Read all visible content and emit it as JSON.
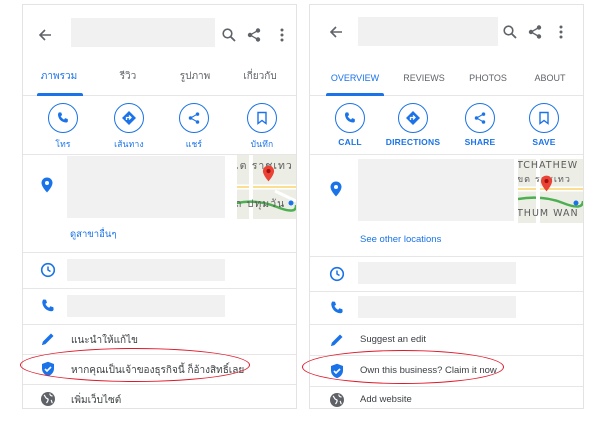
{
  "colors": {
    "accent": "#1a73e8",
    "placeholder_gray": "#f1f1f1",
    "highlight_oval": "#e0192a",
    "map_pin": "#ea4335"
  },
  "panels": [
    {
      "language": "th",
      "icons": {
        "back": "arrow-left-icon",
        "search": "search-icon",
        "share": "share-icon",
        "more": "more-vert-icon"
      },
      "tabs": [
        "ภาพรวม",
        "รีวิว",
        "รูปภาพ",
        "เกี่ยวกับ"
      ],
      "active_tab": 0,
      "actions": [
        {
          "label": "โทร",
          "icon": "phone-icon"
        },
        {
          "label": "เส้นทาง",
          "icon": "directions-icon"
        },
        {
          "label": "แชร์",
          "icon": "share-icon"
        },
        {
          "label": "บันทึก",
          "icon": "bookmark-icon"
        }
      ],
      "map_text": [
        "เต ราชเทว",
        "ถ ปทุมวัน"
      ],
      "other_locations": "ดูสาขาอื่นๆ",
      "suggest_edit": "แนะนำให้แก้ไข",
      "claim_business": "หากคุณเป็นเจ้าของธุรกิจนี้ ก็อ้างสิทธิ์เลย",
      "add_website": "เพิ่มเว็บไซต์"
    },
    {
      "language": "en",
      "icons": {
        "back": "arrow-left-icon",
        "search": "search-icon",
        "share": "share-icon",
        "more": "more-vert-icon"
      },
      "tabs": [
        "OVERVIEW",
        "REVIEWS",
        "PHOTOS",
        "ABOUT"
      ],
      "active_tab": 0,
      "actions": [
        {
          "label": "CALL",
          "icon": "phone-icon"
        },
        {
          "label": "DIRECTIONS",
          "icon": "directions-icon"
        },
        {
          "label": "SHARE",
          "icon": "share-icon"
        },
        {
          "label": "SAVE",
          "icon": "bookmark-icon"
        }
      ],
      "map_text": [
        "TCHATHEW",
        "ขต ราชเทว",
        "THUM WAN"
      ],
      "other_locations": "See other locations",
      "suggest_edit": "Suggest an edit",
      "claim_business": "Own this business? Claim it now",
      "add_website": "Add website"
    }
  ]
}
